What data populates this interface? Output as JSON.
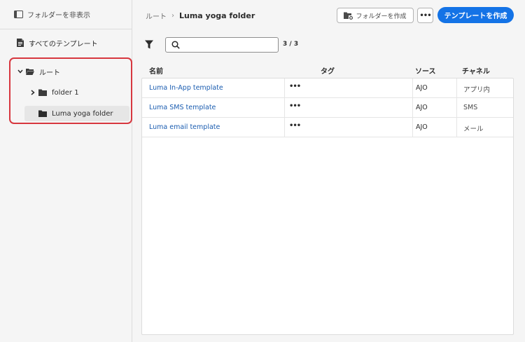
{
  "sidebar": {
    "hide_folders_label": "フォルダーを非表示",
    "all_templates_label": "すべてのテンプレート",
    "tree": {
      "root_label": "ルート",
      "folder1_label": "folder 1",
      "selected_label": "Luma yoga folder"
    }
  },
  "header": {
    "breadcrumb_root": "ルート",
    "breadcrumb_sep": "›",
    "breadcrumb_current": "Luma yoga folder",
    "create_folder_label": "フォルダーを作成",
    "more_label": "•••",
    "create_template_label": "テンプレートを作成"
  },
  "toolbar": {
    "search_placeholder": "",
    "search_value": "",
    "count": "3 / 3"
  },
  "table": {
    "columns": {
      "name": "名前",
      "tags": "タグ",
      "source": "ソース",
      "channel": "チャネル"
    },
    "rows": [
      {
        "name": "Luma In-App template",
        "tags": "•••",
        "source": "AJO",
        "channel": "アプリ内"
      },
      {
        "name": "Luma SMS template",
        "tags": "•••",
        "source": "AJO",
        "channel": "SMS"
      },
      {
        "name": "Luma email template",
        "tags": "•••",
        "source": "AJO",
        "channel": "メール"
      }
    ]
  },
  "colors": {
    "accent": "#1473e6",
    "highlight_border": "#d7373f",
    "link": "#1a5cb0"
  },
  "icons": {
    "hide_folders": "panel-icon",
    "all_templates": "document-icon",
    "tree_chevron": "chevron-icon",
    "folder": "folder-icon",
    "create_folder": "folder-add-icon",
    "filter": "filter-icon",
    "search": "search-icon"
  }
}
